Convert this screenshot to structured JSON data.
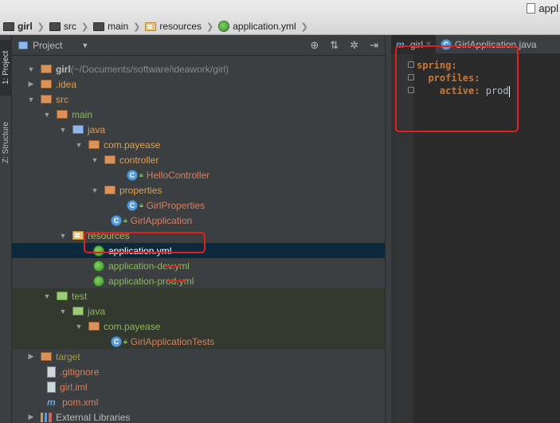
{
  "breadcrumbs": [
    {
      "label": "girl",
      "icon": "folder-icon"
    },
    {
      "label": "src",
      "icon": "folder-icon"
    },
    {
      "label": "main",
      "icon": "folder-icon"
    },
    {
      "label": "resources",
      "icon": "resources-folder-icon"
    },
    {
      "label": "application.yml",
      "icon": "yml-file-icon"
    }
  ],
  "title_right": "appl",
  "stripe": {
    "project_tab": "1: Project",
    "structure_tab": "Z: Structure"
  },
  "project_panel": {
    "header_label": "Project",
    "tree": [
      {
        "label": "girl",
        "suffix": " (~/Documents/software/ideawork/girl)",
        "icon": "folder-icon"
      },
      {
        "label": ".idea",
        "icon": "folder-icon"
      },
      {
        "label": "src",
        "icon": "folder-icon"
      },
      {
        "label": "main",
        "icon": "folder-icon"
      },
      {
        "label": "java",
        "icon": "source-folder-icon"
      },
      {
        "label": "com.payease",
        "icon": "package-icon"
      },
      {
        "label": "controller",
        "icon": "package-icon"
      },
      {
        "label": "HelloController",
        "icon": "class-icon"
      },
      {
        "label": "properties",
        "icon": "package-icon"
      },
      {
        "label": "GirlProperties",
        "icon": "class-icon"
      },
      {
        "label": "GirlApplication",
        "icon": "spring-boot-class-icon"
      },
      {
        "label": "resources",
        "icon": "resources-folder-icon"
      },
      {
        "label": "application.yml",
        "icon": "yml-file-icon"
      },
      {
        "label": "application-dev.yml",
        "icon": "yml-file-icon"
      },
      {
        "label": "application-prod.yml",
        "icon": "yml-file-icon"
      },
      {
        "label": "test",
        "icon": "test-folder-icon"
      },
      {
        "label": "java",
        "icon": "test-source-folder-icon"
      },
      {
        "label": "com.payease",
        "icon": "package-icon"
      },
      {
        "label": "GirlApplicationTests",
        "icon": "class-icon"
      },
      {
        "label": "target",
        "icon": "excluded-folder-icon"
      },
      {
        "label": ".gitignore",
        "icon": "file-icon"
      },
      {
        "label": "girl.iml",
        "icon": "iml-file-icon"
      },
      {
        "label": "pom.xml",
        "icon": "maven-icon"
      },
      {
        "label": "External Libraries",
        "icon": "libraries-icon"
      }
    ]
  },
  "editor": {
    "tabs": [
      {
        "label": "girl",
        "icon": "maven-icon"
      },
      {
        "label": "GirlApplication.java",
        "icon": "class-icon"
      }
    ],
    "code": {
      "line1_key": "spring:",
      "line2_key": "profiles:",
      "line3_key": "active:",
      "line3_value": " prod"
    }
  },
  "colors": {
    "annotation": "#e02020",
    "selection": "#0d293e",
    "yaml_key": "#cc7832"
  }
}
